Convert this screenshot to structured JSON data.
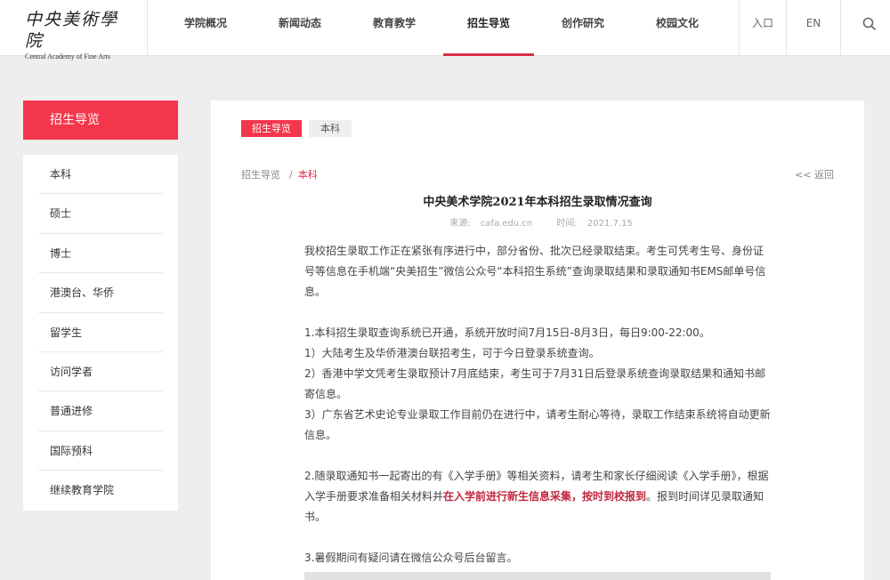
{
  "logo": {
    "name_cn": "中央美術學院",
    "name_en": "Central Academy of Fine Arts"
  },
  "nav": {
    "items": [
      {
        "label": "学院概况"
      },
      {
        "label": "新闻动态"
      },
      {
        "label": "教育教学"
      },
      {
        "label": "招生导览"
      },
      {
        "label": "创作研究"
      },
      {
        "label": "校园文化"
      }
    ],
    "active_index": 3,
    "entry_label": "入口",
    "lang_label": "EN",
    "search_icon": "search-icon"
  },
  "sidebar": {
    "heading": "招生导览",
    "items": [
      {
        "label": "本科"
      },
      {
        "label": "硕士"
      },
      {
        "label": "博士"
      },
      {
        "label": "港澳台、华侨"
      },
      {
        "label": "留学生"
      },
      {
        "label": "访问学者"
      },
      {
        "label": "普通进修"
      },
      {
        "label": "国际预科"
      },
      {
        "label": "继续教育学院"
      }
    ]
  },
  "tabs": {
    "active": "招生导览",
    "other": "本科"
  },
  "breadcrumb": {
    "root": "招生导览",
    "separator": "/",
    "current": "本科"
  },
  "back_label": "<< 返回",
  "article": {
    "title": "中央美术学院2021年本科招生录取情况查询",
    "source_label": "来源:",
    "source": "cafa.edu.cn",
    "time_label": "时间:",
    "time": "2021.7.15",
    "para1": "我校招生录取工作正在紧张有序进行中，部分省份、批次已经录取结束。考生可凭考生号、身份证号等信息在手机端“央美招生”微信公众号“本科招生系统”查询录取结果和录取通知书EMS邮单号信息。",
    "item1": "1.本科招生录取查询系统已开通，系统开放时间7月15日-8月3日，每日9:00-22:00。",
    "item1_1": "1）大陆考生及华侨港澳台联招考生，可于今日登录系统查询。",
    "item1_2": "2）香港中学文凭考生录取预计7月底结束，考生可于7月31日后登录系统查询录取结果和通知书邮寄信息。",
    "item1_3": "3）广东省艺术史论专业录取工作目前仍在进行中，请考生耐心等待，录取工作结束系统将自动更新信息。",
    "item2_a": "2.随录取通知书一起寄出的有《入学手册》等相关资料，请考生和家长仔细阅读《入学手册》，根据入学手册要求准备相关材料并",
    "item2_hl": "在入学前进行新生信息采集，按时到校报到",
    "item2_b": "。报到时间详见录取通知书。",
    "item3": "3.暑假期间有疑问请在微信公众号后台留言。"
  },
  "colors": {
    "accent": "#f4364c",
    "highlight": "#c0283e"
  }
}
